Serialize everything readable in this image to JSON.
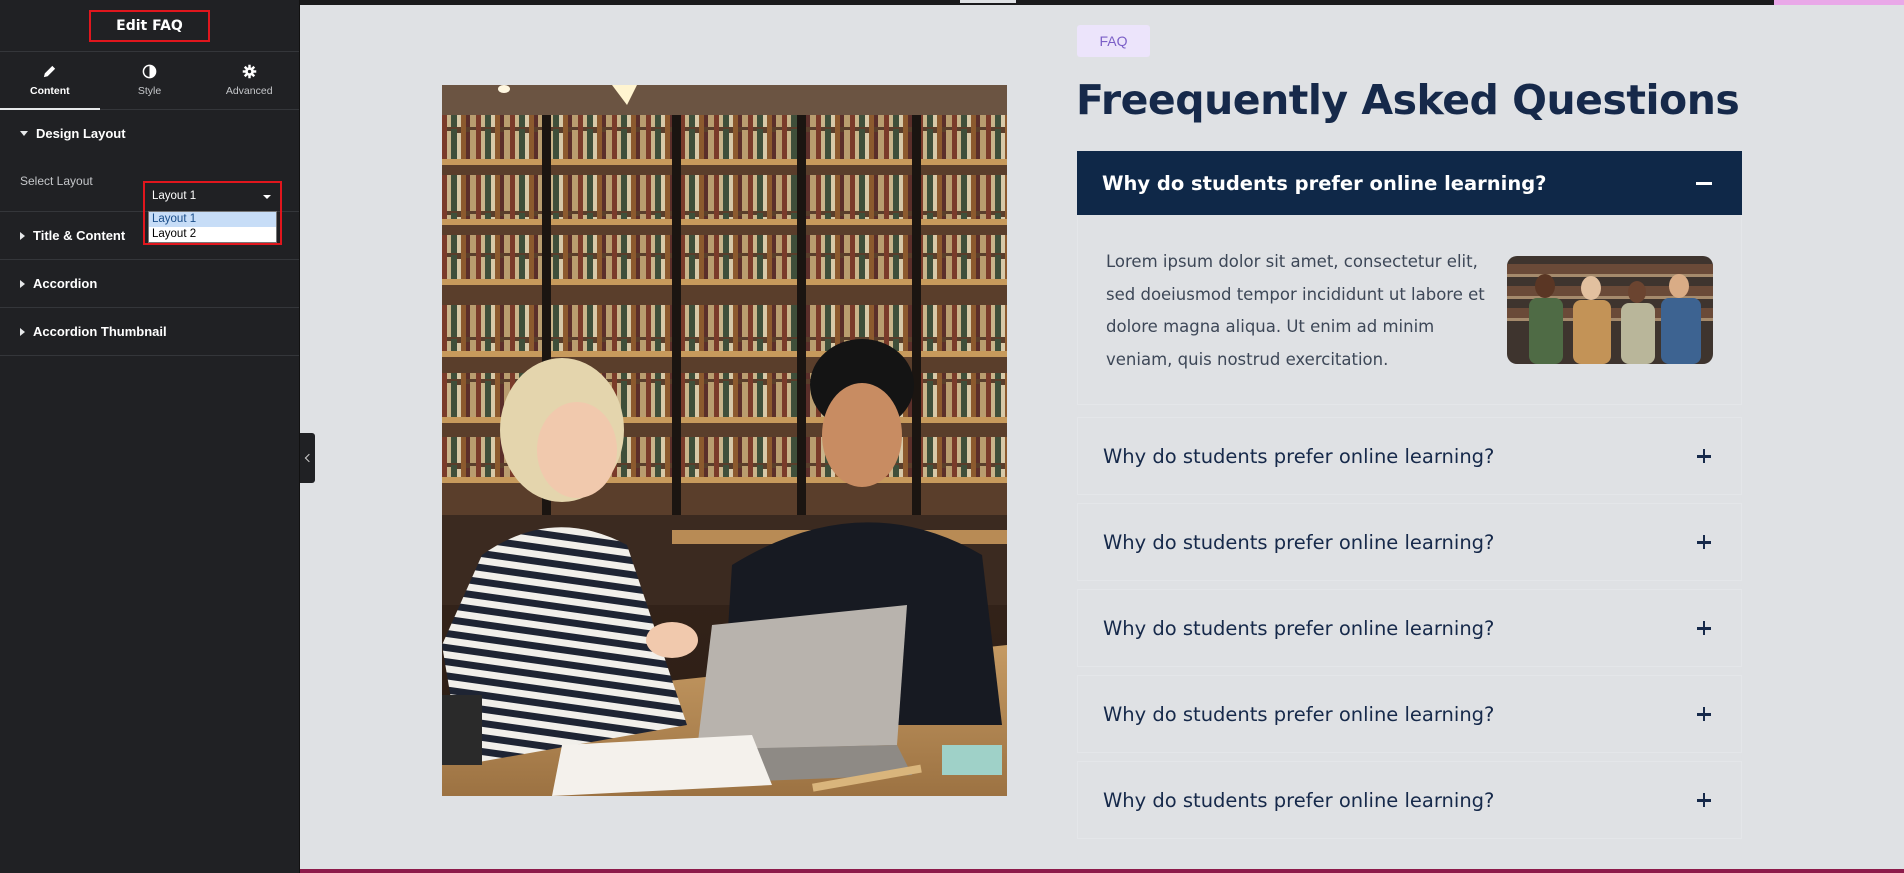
{
  "panel": {
    "title": "Edit FAQ",
    "tabs": [
      {
        "label": "Content",
        "icon": "pencil-icon",
        "active": true
      },
      {
        "label": "Style",
        "icon": "half-circle-icon"
      },
      {
        "label": "Advanced",
        "icon": "gear-icon"
      }
    ],
    "sections": {
      "design_layout": "Design Layout",
      "title_content": "Title & Content",
      "accordion": "Accordion",
      "accordion_thumbnail": "Accordion Thumbnail"
    },
    "select_layout": {
      "label": "Select Layout",
      "value": "Layout 1",
      "options": [
        "Layout 1",
        "Layout 2"
      ]
    }
  },
  "faq": {
    "badge": "FAQ",
    "title": "Freequently Asked Questions",
    "open_item": {
      "question": "Why do students prefer online learning?",
      "answer": "Lorem ipsum dolor sit amet, consectetur elit, sed doeiusmod tempor incididunt ut labore et dolore magna aliqua. Ut enim ad minim veniam, quis nostrud exercitation."
    },
    "items": [
      "Why do students prefer online learning?",
      "Why do students prefer online learning?",
      "Why do students prefer online learning?",
      "Why do students prefer online learning?",
      "Why do students prefer online learning?"
    ]
  },
  "colors": {
    "panel_bg": "#202124",
    "highlight_border": "#e0161d",
    "accordion_active": "#0f2848",
    "heading": "#16294a",
    "badge_bg": "#ece4fb",
    "badge_text": "#7b5fc7"
  }
}
